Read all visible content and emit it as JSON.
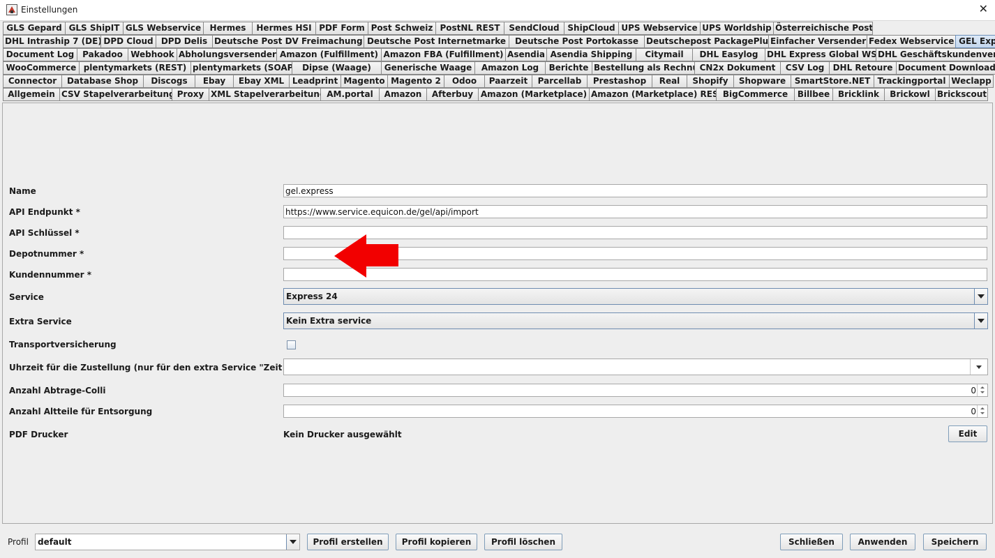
{
  "window": {
    "title": "Einstellungen",
    "close_glyph": "✕"
  },
  "tabs": {
    "row1": [
      "GLS Gepard",
      "GLS ShipIT",
      "GLS Webservice",
      "Hermes",
      "Hermes HSI",
      "PDF Form",
      "Post Schweiz",
      "PostNL REST",
      "SendCloud",
      "ShipCloud",
      "UPS Webservice",
      "UPS Worldship",
      "Österreichische Post"
    ],
    "row2": [
      "DHL Intraship 7 (DE)",
      "DPD Cloud",
      "DPD Delis",
      "Deutsche Post DV Freimachung",
      "Deutsche Post Internetmarke",
      "Deutsche Post Portokasse",
      "Deutschepost PackagePlus",
      "Einfacher Versender",
      "Fedex Webservice",
      "GEL Express"
    ],
    "row3": [
      "Document Log",
      "Pakadoo",
      "Webhook",
      "Abholungsversender",
      "Amazon (Fulfillment)",
      "Amazon FBA (Fulfillment)",
      "Asendia",
      "Asendia Shipping",
      "Citymail",
      "DHL Easylog",
      "DHL Express Global WS",
      "DHL Geschäftskundenversand"
    ],
    "row4": [
      "WooCommerce",
      "plentymarkets (REST)",
      "plentymarkets (SOAP)",
      "Dipse (Waage)",
      "Generische Waage",
      "Amazon Log",
      "Berichte",
      "Bestellung als Rechnung",
      "CN2x Dokument",
      "CSV Log",
      "DHL Retoure",
      "Document Downloader"
    ],
    "row5": [
      "Connector",
      "Database Shop",
      "Discogs",
      "Ebay",
      "Ebay XML",
      "Leadprint",
      "Magento",
      "Magento 2",
      "Odoo",
      "Paarzeit",
      "Parcellab",
      "Prestashop",
      "Real",
      "Shopify",
      "Shopware",
      "SmartStore.NET",
      "Trackingportal",
      "Weclapp"
    ],
    "row6": [
      "Allgemein",
      "CSV Stapelverarbeitung",
      "Proxy",
      "XML Stapelverarbeitung",
      "AM.portal",
      "Amazon",
      "Afterbuy",
      "Amazon (Marketplace)",
      "Amazon (Marketplace) REST",
      "BigCommerce",
      "Billbee",
      "Bricklink",
      "Brickowl",
      "Brickscout"
    ],
    "active": "GEL Express"
  },
  "form": {
    "name_label": "Name",
    "name_value": "gel.express",
    "api_endpoint_label": "API Endpunkt *",
    "api_endpoint_value": "https://www.service.equicon.de/gel/api/import",
    "api_key_label": "API Schlüssel *",
    "api_key_value": "",
    "depot_label": "Depotnummer *",
    "depot_value": "",
    "customer_label": "Kundennummer *",
    "customer_value": "",
    "service_label": "Service",
    "service_value": "Express 24",
    "extra_service_label": "Extra Service",
    "extra_service_value": "Kein Extra service",
    "insurance_label": "Transportversicherung",
    "time_label": "Uhrzeit für die Zustellung (nur für den extra Service \"Zeit festlegen\")",
    "time_value": "",
    "pickup_colli_label": "Anzahl Abtrage-Colli",
    "pickup_colli_value": "0",
    "old_parts_label": "Anzahl Altteile für Entsorgung",
    "old_parts_value": "0",
    "pdf_printer_label": "PDF Drucker",
    "pdf_printer_value": "Kein Drucker ausgewählt",
    "edit_label": "Edit"
  },
  "footer": {
    "profile_label": "Profil",
    "profile_value": "default",
    "create_label": "Profil erstellen",
    "copy_label": "Profil kopieren",
    "delete_label": "Profil löschen",
    "close_label": "Schließen",
    "apply_label": "Anwenden",
    "save_label": "Speichern"
  },
  "colors": {
    "arrow": "#f20000",
    "active_tab": "#c4d7ee"
  }
}
